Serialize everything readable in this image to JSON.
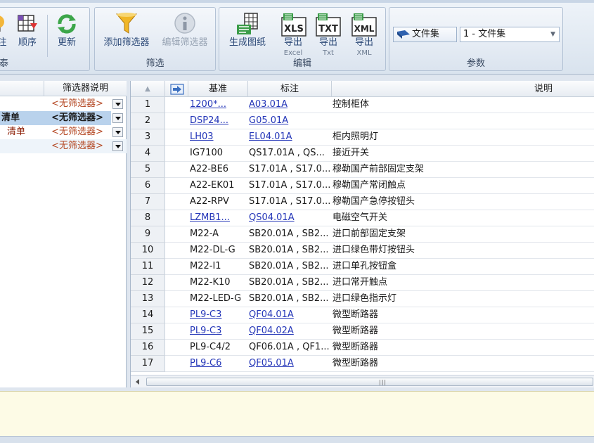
{
  "ribbon": {
    "group1": {
      "items": [
        {
          "label": "注",
          "icon": "bulb-icon"
        },
        {
          "label": "顺序",
          "icon": "sort-grid-icon"
        },
        {
          "label": "更新",
          "icon": "refresh-icon"
        }
      ],
      "label": "泰"
    },
    "filter_group": {
      "label": "筛选",
      "add_filter": "添加筛选器",
      "edit_filter": "编辑筛选器"
    },
    "edit_group": {
      "label": "编辑",
      "generate": "生成图纸",
      "export_xls": {
        "label": "导出",
        "sub": "Excel",
        "badge": "XLS"
      },
      "export_txt": {
        "label": "导出",
        "sub": "Txt",
        "badge": "TXT"
      },
      "export_xml": {
        "label": "导出",
        "sub": "XML",
        "badge": "XML"
      }
    },
    "params_group": {
      "label": "参数",
      "fileset_button": "文件集",
      "fileset_value": "1 - 文件集"
    }
  },
  "left_panel": {
    "header": "筛选器说明",
    "rows": [
      {
        "name": "",
        "filter": "<无筛选器>",
        "selected": false
      },
      {
        "name": "清单",
        "filter": "<无筛选器>",
        "selected": true
      },
      {
        "name": "清单",
        "filter": "<无筛选器>",
        "selected": false
      },
      {
        "name": "",
        "filter": "<无筛选器>",
        "selected": false
      }
    ]
  },
  "grid": {
    "headers": {
      "sort": "▲",
      "base": "基准",
      "mark": "标注",
      "desc": "说明"
    },
    "rows": [
      {
        "n": "1",
        "base": "1200*...",
        "mark": "A03.01A",
        "desc": "控制柜体",
        "link": true
      },
      {
        "n": "2",
        "base": "DSP24...",
        "mark": "G05.01A",
        "desc": "",
        "link": true
      },
      {
        "n": "3",
        "base": "LH03",
        "mark": "EL04.01A",
        "desc": "柜内照明灯",
        "link": true
      },
      {
        "n": "4",
        "base": "IG7100",
        "mark": "QS17.01A , QS...",
        "desc": "接近开关",
        "link": false
      },
      {
        "n": "5",
        "base": "A22-BE6",
        "mark": "S17.01A , S17.0...",
        "desc": "穆勒国产前部固定支架",
        "link": false
      },
      {
        "n": "6",
        "base": "A22-EK01",
        "mark": "S17.01A , S17.0...",
        "desc": "穆勒国产常闭触点",
        "link": false
      },
      {
        "n": "7",
        "base": "A22-RPV",
        "mark": "S17.01A , S17.0...",
        "desc": "穆勒国产急停按钮头",
        "link": false
      },
      {
        "n": "8",
        "base": "LZMB1...",
        "mark": "QS04.01A",
        "desc": "电磁空气开关",
        "link": true
      },
      {
        "n": "9",
        "base": "M22-A",
        "mark": "SB20.01A , SB2...",
        "desc": "进口前部固定支架",
        "link": false
      },
      {
        "n": "10",
        "base": "M22-DL-G",
        "mark": "SB20.01A , SB2...",
        "desc": "进口绿色带灯按钮头",
        "link": false
      },
      {
        "n": "11",
        "base": "M22-I1",
        "mark": "SB20.01A , SB2...",
        "desc": "进口单孔按钮盒",
        "link": false
      },
      {
        "n": "12",
        "base": "M22-K10",
        "mark": "SB20.01A , SB2...",
        "desc": "进口常开触点",
        "link": false
      },
      {
        "n": "13",
        "base": "M22-LED-G",
        "mark": "SB20.01A , SB2...",
        "desc": "进口绿色指示灯",
        "link": false
      },
      {
        "n": "14",
        "base": "PL9-C3",
        "mark": "QF04.01A",
        "desc": "微型断路器",
        "link": true
      },
      {
        "n": "15",
        "base": "PL9-C3",
        "mark": "QF04.02A",
        "desc": "微型断路器",
        "link": true
      },
      {
        "n": "16",
        "base": "PL9-C4/2",
        "mark": "QF06.01A , QF1...",
        "desc": "微型断路器",
        "link": false
      },
      {
        "n": "17",
        "base": "PL9-C6",
        "mark": "QF05.01A",
        "desc": "微型断路器",
        "link": true
      }
    ]
  },
  "scrollbar": {
    "grip": "|||"
  }
}
